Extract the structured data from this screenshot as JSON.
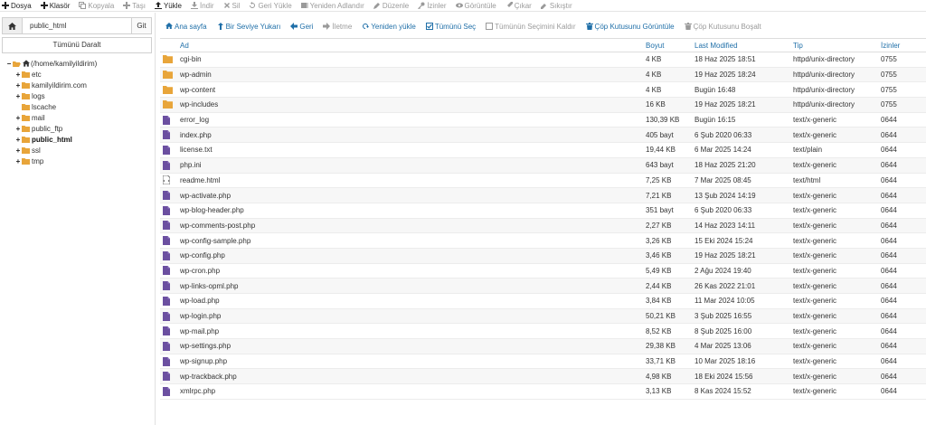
{
  "toolbar": [
    {
      "label": "Dosya",
      "icon": "plus-icon",
      "enabled": true
    },
    {
      "label": "Klasör",
      "icon": "plus-icon",
      "enabled": true
    },
    {
      "label": "Kopyala",
      "icon": "copy-icon",
      "enabled": false
    },
    {
      "label": "Taşı",
      "icon": "move-icon",
      "enabled": false
    },
    {
      "label": "Yükle",
      "icon": "upload-icon",
      "enabled": true
    },
    {
      "label": "İndir",
      "icon": "download-icon",
      "enabled": false
    },
    {
      "label": "Sil",
      "icon": "delete-icon",
      "enabled": false
    },
    {
      "label": "Geri Yükle",
      "icon": "restore-icon",
      "enabled": false
    },
    {
      "label": "Yeniden Adlandır",
      "icon": "rename-icon",
      "enabled": false
    },
    {
      "label": "Düzenle",
      "icon": "edit-icon",
      "enabled": false
    },
    {
      "label": "İzinler",
      "icon": "key-icon",
      "enabled": false
    },
    {
      "label": "Görüntüle",
      "icon": "eye-icon",
      "enabled": false
    },
    {
      "label": "Çıkar",
      "icon": "extract-icon",
      "enabled": false
    },
    {
      "label": "Sıkıştır",
      "icon": "compress-icon",
      "enabled": false
    }
  ],
  "sidebar": {
    "path_value": "public_html",
    "go_label": "Git",
    "collapse_label": "Tümünü Daralt",
    "tree": [
      {
        "label": "(/home/kamilyildirim)",
        "toggle": "−",
        "indent": 0,
        "home": true,
        "bold": false
      },
      {
        "label": "etc",
        "toggle": "+",
        "indent": 1,
        "bold": false
      },
      {
        "label": "kamilyildirim.com",
        "toggle": "+",
        "indent": 1,
        "bold": false
      },
      {
        "label": "logs",
        "toggle": "+",
        "indent": 1,
        "bold": false
      },
      {
        "label": "lscache",
        "toggle": "",
        "indent": 1,
        "bold": false
      },
      {
        "label": "mail",
        "toggle": "+",
        "indent": 1,
        "bold": false
      },
      {
        "label": "public_ftp",
        "toggle": "+",
        "indent": 1,
        "bold": false
      },
      {
        "label": "public_html",
        "toggle": "+",
        "indent": 1,
        "bold": true
      },
      {
        "label": "ssl",
        "toggle": "+",
        "indent": 1,
        "bold": false
      },
      {
        "label": "tmp",
        "toggle": "+",
        "indent": 1,
        "bold": false
      }
    ]
  },
  "actions": [
    {
      "label": "Ana sayfa",
      "icon": "home-icon",
      "enabled": true
    },
    {
      "label": "Bir Seviye Yukarı",
      "icon": "level-up-icon",
      "enabled": true
    },
    {
      "label": "Geri",
      "icon": "arrow-left-icon",
      "enabled": true
    },
    {
      "label": "İletme",
      "icon": "arrow-right-icon",
      "enabled": false
    },
    {
      "label": "Yeniden yükle",
      "icon": "refresh-icon",
      "enabled": true
    },
    {
      "label": "Tümünü Seç",
      "icon": "checkbox-checked-icon",
      "enabled": true
    },
    {
      "label": "Tümünün Seçimini Kaldır",
      "icon": "checkbox-empty-icon",
      "enabled": false
    },
    {
      "label": "Çöp Kutusunu Görüntüle",
      "icon": "trash-icon",
      "enabled": true
    },
    {
      "label": "Çöp Kutusunu Boşalt",
      "icon": "trash-icon",
      "enabled": false
    }
  ],
  "table": {
    "headers": {
      "name": "Ad",
      "size": "Boyut",
      "modified": "Last Modified",
      "type": "Tip",
      "perms": "İzinler"
    },
    "rows": [
      {
        "kind": "folder",
        "name": "cgi-bin",
        "size": "4 KB",
        "modified": "18 Haz 2025 18:51",
        "type": "httpd/unix-directory",
        "perms": "0755"
      },
      {
        "kind": "folder",
        "name": "wp-admin",
        "size": "4 KB",
        "modified": "19 Haz 2025 18:24",
        "type": "httpd/unix-directory",
        "perms": "0755"
      },
      {
        "kind": "folder",
        "name": "wp-content",
        "size": "4 KB",
        "modified": "Bugün 16:48",
        "type": "httpd/unix-directory",
        "perms": "0755"
      },
      {
        "kind": "folder",
        "name": "wp-includes",
        "size": "16 KB",
        "modified": "19 Haz 2025 18:21",
        "type": "httpd/unix-directory",
        "perms": "0755"
      },
      {
        "kind": "file",
        "name": "error_log",
        "size": "130,39 KB",
        "modified": "Bugün 16:15",
        "type": "text/x-generic",
        "perms": "0644"
      },
      {
        "kind": "file",
        "name": "index.php",
        "size": "405 bayt",
        "modified": "6 Şub 2020 06:33",
        "type": "text/x-generic",
        "perms": "0644"
      },
      {
        "kind": "file",
        "name": "license.txt",
        "size": "19,44 KB",
        "modified": "6 Mar 2025 14:24",
        "type": "text/plain",
        "perms": "0644"
      },
      {
        "kind": "file",
        "name": "php.ini",
        "size": "643 bayt",
        "modified": "18 Haz 2025 21:20",
        "type": "text/x-generic",
        "perms": "0644"
      },
      {
        "kind": "html",
        "name": "readme.html",
        "size": "7,25 KB",
        "modified": "7 Mar 2025 08:45",
        "type": "text/html",
        "perms": "0644"
      },
      {
        "kind": "file",
        "name": "wp-activate.php",
        "size": "7,21 KB",
        "modified": "13 Şub 2024 14:19",
        "type": "text/x-generic",
        "perms": "0644"
      },
      {
        "kind": "file",
        "name": "wp-blog-header.php",
        "size": "351 bayt",
        "modified": "6 Şub 2020 06:33",
        "type": "text/x-generic",
        "perms": "0644"
      },
      {
        "kind": "file",
        "name": "wp-comments-post.php",
        "size": "2,27 KB",
        "modified": "14 Haz 2023 14:11",
        "type": "text/x-generic",
        "perms": "0644"
      },
      {
        "kind": "file",
        "name": "wp-config-sample.php",
        "size": "3,26 KB",
        "modified": "15 Eki 2024 15:24",
        "type": "text/x-generic",
        "perms": "0644"
      },
      {
        "kind": "file",
        "name": "wp-config.php",
        "size": "3,46 KB",
        "modified": "19 Haz 2025 18:21",
        "type": "text/x-generic",
        "perms": "0644"
      },
      {
        "kind": "file",
        "name": "wp-cron.php",
        "size": "5,49 KB",
        "modified": "2 Ağu 2024 19:40",
        "type": "text/x-generic",
        "perms": "0644"
      },
      {
        "kind": "file",
        "name": "wp-links-opml.php",
        "size": "2,44 KB",
        "modified": "26 Kas 2022 21:01",
        "type": "text/x-generic",
        "perms": "0644"
      },
      {
        "kind": "file",
        "name": "wp-load.php",
        "size": "3,84 KB",
        "modified": "11 Mar 2024 10:05",
        "type": "text/x-generic",
        "perms": "0644"
      },
      {
        "kind": "file",
        "name": "wp-login.php",
        "size": "50,21 KB",
        "modified": "3 Şub 2025 16:55",
        "type": "text/x-generic",
        "perms": "0644"
      },
      {
        "kind": "file",
        "name": "wp-mail.php",
        "size": "8,52 KB",
        "modified": "8 Şub 2025 16:00",
        "type": "text/x-generic",
        "perms": "0644"
      },
      {
        "kind": "file",
        "name": "wp-settings.php",
        "size": "29,38 KB",
        "modified": "4 Mar 2025 13:06",
        "type": "text/x-generic",
        "perms": "0644"
      },
      {
        "kind": "file",
        "name": "wp-signup.php",
        "size": "33,71 KB",
        "modified": "10 Mar 2025 18:16",
        "type": "text/x-generic",
        "perms": "0644"
      },
      {
        "kind": "file",
        "name": "wp-trackback.php",
        "size": "4,98 KB",
        "modified": "18 Eki 2024 15:56",
        "type": "text/x-generic",
        "perms": "0644"
      },
      {
        "kind": "file",
        "name": "xmlrpc.php",
        "size": "3,13 KB",
        "modified": "8 Kas 2024 15:52",
        "type": "text/x-generic",
        "perms": "0644"
      }
    ]
  },
  "colors": {
    "folder": "#e8a53a",
    "file": "#6b4fa0",
    "link": "#1f6fa8",
    "disabled": "#9a9a9a"
  }
}
